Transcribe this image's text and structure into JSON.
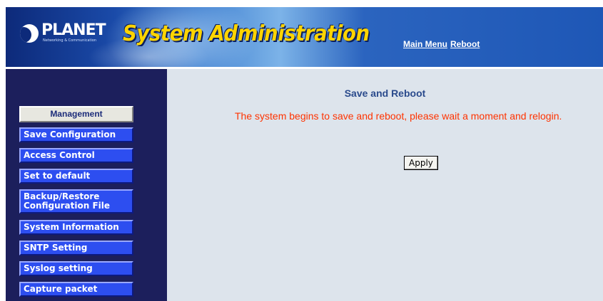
{
  "header": {
    "logo_name": "PLANET",
    "logo_tagline": "Networking & Communication",
    "title": "System Administration",
    "links": [
      "Main Menu",
      "Reboot"
    ]
  },
  "sidebar": {
    "heading": "Management",
    "items": [
      {
        "label": "Save Configuration"
      },
      {
        "label": "Access Control"
      },
      {
        "label": "Set to default"
      },
      {
        "label": "Backup/Restore Configuration File"
      },
      {
        "label": "System Information"
      },
      {
        "label": "SNTP Setting"
      },
      {
        "label": "Syslog setting"
      },
      {
        "label": "Capture packet"
      }
    ]
  },
  "main": {
    "title": "Save and Reboot",
    "message": "The system begins to save and reboot, please wait a moment and relogin.",
    "apply_label": "Apply"
  },
  "colors": {
    "sidebar_bg": "#1c1f5c",
    "menu_item_bg": "#2d4ef0",
    "main_bg": "#dde4ec",
    "title_color": "#2a4a8c",
    "message_color": "#ff3300",
    "banner_title": "#ffd400"
  }
}
